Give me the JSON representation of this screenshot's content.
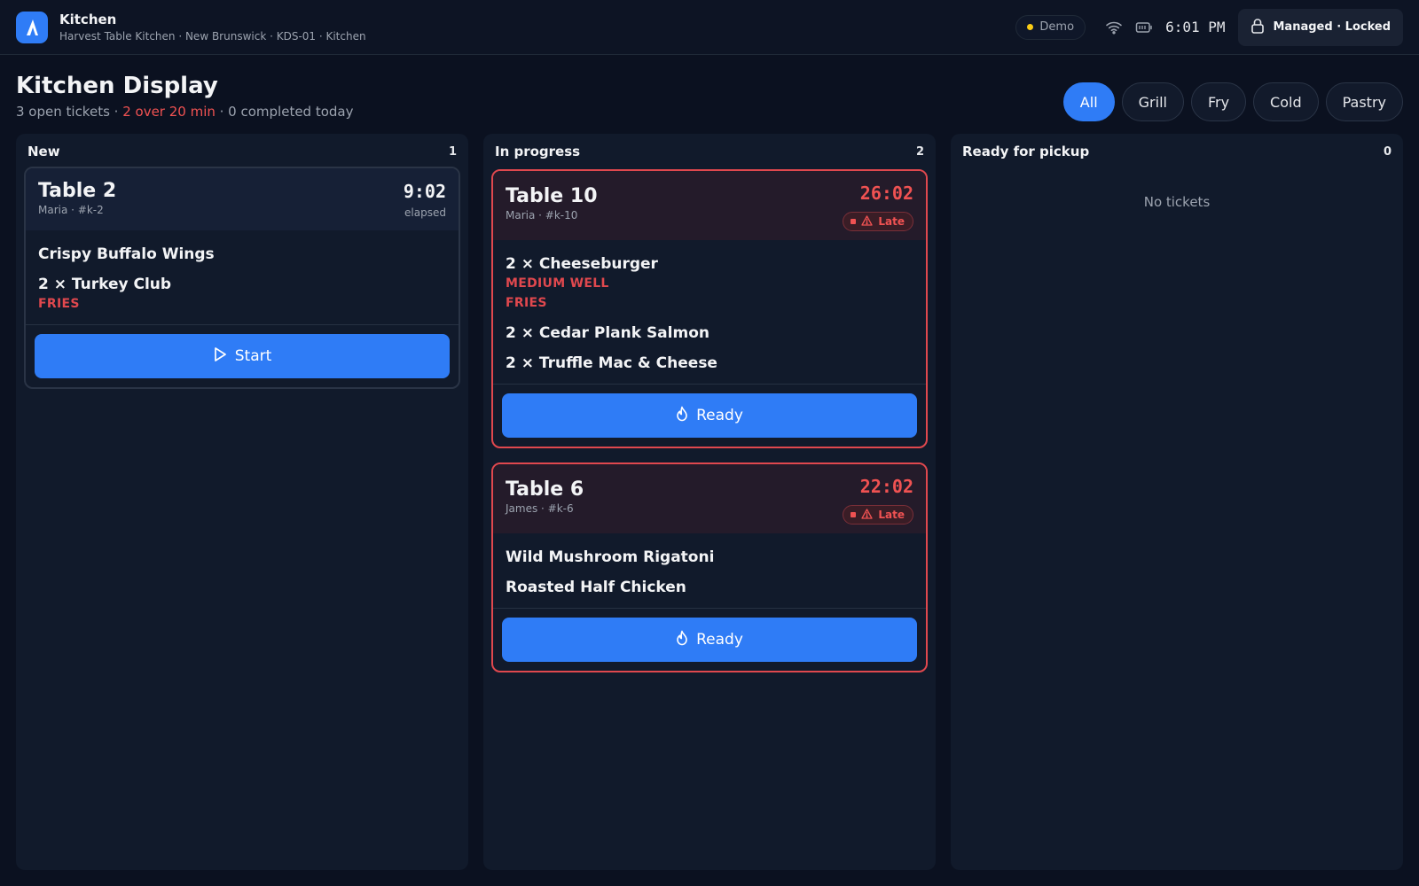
{
  "topbar": {
    "app_title": "Kitchen",
    "app_subtitle": "Harvest Table Kitchen · New Brunswick · KDS-01 · Kitchen",
    "demo_label": "Demo",
    "clock": "6:01 PM",
    "managed_label": "Managed · Locked",
    "icons": [
      "app-logo-icon",
      "wifi-icon",
      "battery-icon",
      "lock-icon"
    ]
  },
  "header": {
    "title": "Kitchen Display",
    "summary_open": "3 open tickets · ",
    "summary_late": "2 over 20 min",
    "summary_done": " · 0 completed today"
  },
  "filters": [
    {
      "label": "All",
      "active": true
    },
    {
      "label": "Grill",
      "active": false
    },
    {
      "label": "Fry",
      "active": false
    },
    {
      "label": "Cold",
      "active": false
    },
    {
      "label": "Pastry",
      "active": false
    }
  ],
  "columns": {
    "new": {
      "title": "New",
      "count": "1",
      "tickets": [
        {
          "table": "Table 2",
          "meta": "Maria · #k-2",
          "timer": "9:02",
          "elapsed_label": "elapsed",
          "items": [
            {
              "name": "Crispy Buffalo Wings"
            },
            {
              "name": "2 × Turkey Club",
              "mod": "FRIES"
            }
          ],
          "action": "Start"
        }
      ]
    },
    "in_progress": {
      "title": "In progress",
      "count": "2",
      "tickets": [
        {
          "table": "Table 10",
          "meta": "Maria · #k-10",
          "timer": "26:02",
          "badge": "Late",
          "items": [
            {
              "name": "2 × Cheeseburger",
              "mods": [
                "MEDIUM WELL",
                "FRIES"
              ]
            },
            {
              "name": "2 × Cedar Plank Salmon"
            },
            {
              "name": "2 × Truffle Mac & Cheese"
            }
          ],
          "action": "Ready"
        },
        {
          "table": "Table 6",
          "meta": "James · #k-6",
          "timer": "22:02",
          "badge": "Late",
          "items": [
            {
              "name": "Wild Mushroom Rigatoni"
            },
            {
              "name": "Roasted Half Chicken"
            }
          ],
          "action": "Ready"
        }
      ]
    },
    "ready": {
      "title": "Ready for pickup",
      "count": "0",
      "empty": "No tickets"
    }
  },
  "colors": {
    "accent": "#2f7cf6",
    "late": "#f05252",
    "demo_dot": "#facc15",
    "background": "#0b1120"
  }
}
